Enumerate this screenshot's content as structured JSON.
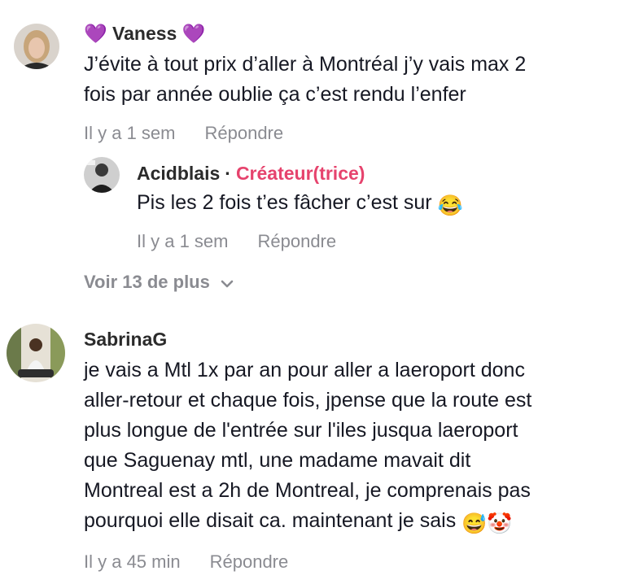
{
  "comments": [
    {
      "username": "💜 Vaness 💜",
      "lines": [
        "J’évite à tout prix d’aller à Montréal j’y vais max 2",
        "fois par année oublie ça c’est rendu l’enfer"
      ],
      "time": "Il y a 1 sem",
      "reply_label": "Répondre",
      "reply": {
        "username": "Acidblais",
        "separator": "·",
        "badge": "Créateur(trice)",
        "text": "Pis les 2 fois t’es fâcher c’est sur",
        "emoji": "😂",
        "time": "Il y a 1 sem",
        "reply_label": "Répondre"
      },
      "more_label": "Voir 13 de plus"
    },
    {
      "username": "SabrinaG",
      "lines": [
        "je vais a Mtl 1x par an pour aller a laeroport donc",
        "aller-retour et chaque fois, jpense que la route est",
        "plus longue de l'entrée sur l'iles jusqua laeroport",
        "que Saguenay mtl, une madame mavait dit",
        "Montreal est a 2h de Montreal, je comprenais pas",
        "pourquoi elle disait ca. maintenant je sais"
      ],
      "emojis": "😅🤡",
      "time": "Il y a 45 min",
      "reply_label": "Répondre"
    }
  ],
  "colors": {
    "creator_badge": "#e6436d",
    "meta_gray": "#8a8b91",
    "text": "#161823"
  }
}
